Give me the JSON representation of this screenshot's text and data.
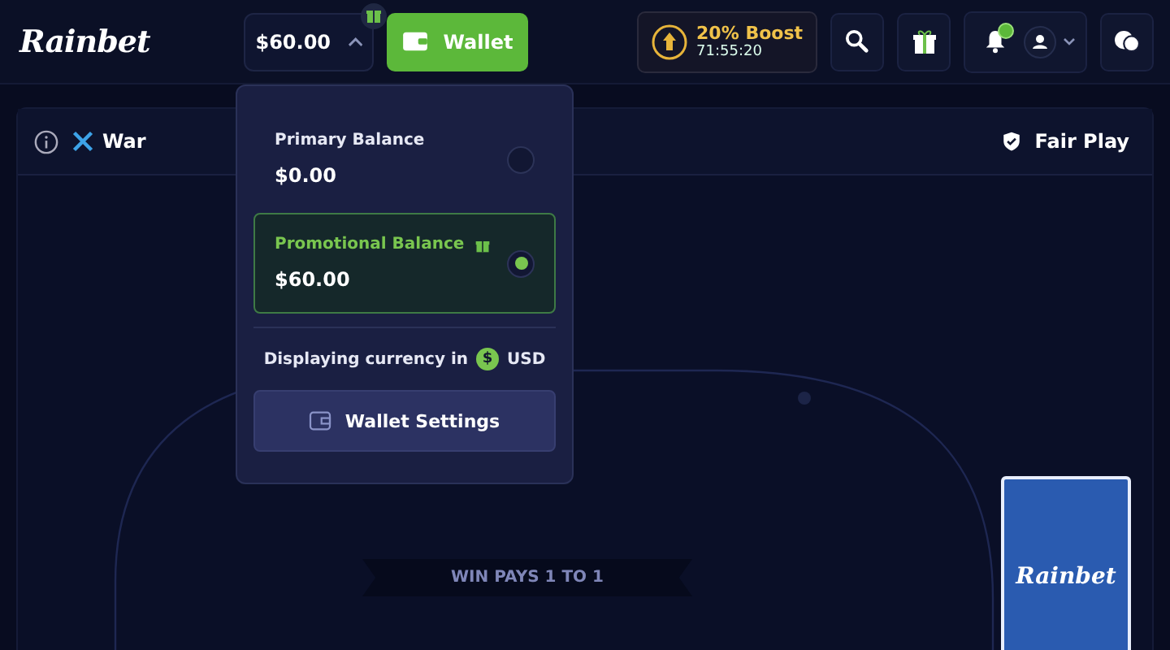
{
  "logo": "Rainbet",
  "balance": {
    "amount": "$60.00",
    "expanded": true
  },
  "wallet_button": "Wallet",
  "boost": {
    "title": "20% Boost",
    "timer": "71:55:20"
  },
  "notifications": {
    "unread": true
  },
  "game": {
    "title": "War",
    "fair_play": "Fair Play",
    "banner": "WIN PAYS 1 TO 1",
    "card_logo": "Rainbet"
  },
  "wallet_menu": {
    "balances": [
      {
        "label": "Primary Balance",
        "amount": "$0.00",
        "kind": "primary",
        "selected": false
      },
      {
        "label": "Promotional Balance",
        "amount": "$60.00",
        "kind": "promo",
        "selected": true
      }
    ],
    "currency_text": "Displaying currency in",
    "currency_symbol": "$",
    "currency": "USD",
    "settings_button": "Wallet Settings"
  }
}
